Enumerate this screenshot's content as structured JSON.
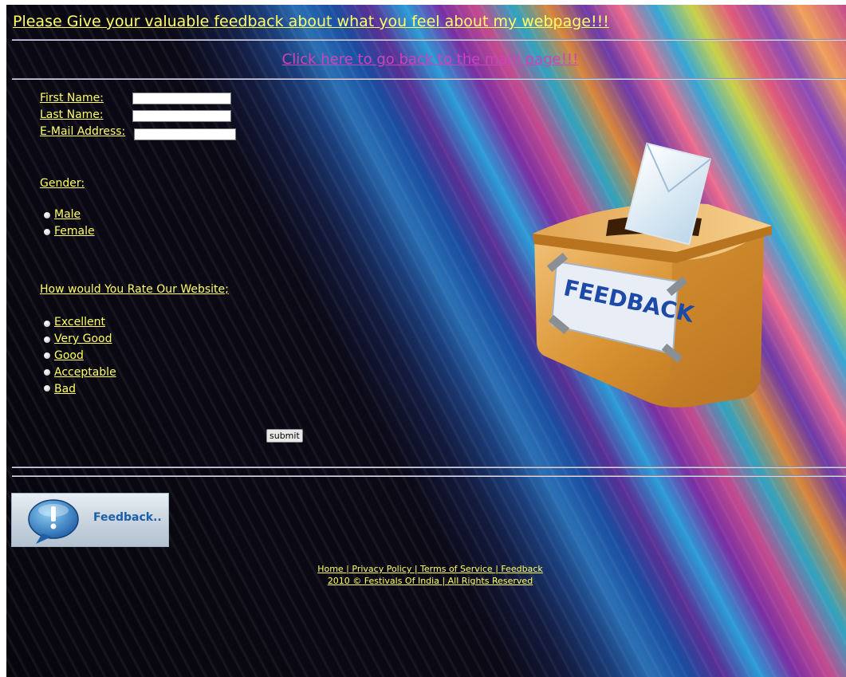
{
  "header": {
    "title": "Please Give your valuable feedback about what you feel about my webpage!!!",
    "back_link": "Click here to go back to the main page!!!"
  },
  "form": {
    "first_name_label": "First Name:",
    "first_name_value": "",
    "last_name_label": "Last Name:",
    "last_name_value": "",
    "email_label": "E-Mail Address:",
    "email_value": "",
    "gender_label": "Gender:",
    "gender_options": [
      "Male",
      "Female"
    ],
    "rating_label": "How would You Rate Our Website;",
    "rating_options": [
      "Excellent",
      "Very Good",
      "Good",
      "Acceptable",
      "Bad"
    ],
    "submit_label": "submit"
  },
  "feedback_button": {
    "label": "Feedback..",
    "icon": "speech-bubble-exclamation-icon"
  },
  "illustration": {
    "label": "FEEDBACK",
    "icon": "ballot-box-envelope-icon"
  },
  "footer": {
    "links": "Home | Privacy Policy | Terms of Service | Feedback",
    "copyright": "2010 © Festivals Of India | All Rights Reserved"
  },
  "colors": {
    "link": "#ffff66",
    "back_link": "#cc44bb",
    "background_dark": "#07060d"
  }
}
